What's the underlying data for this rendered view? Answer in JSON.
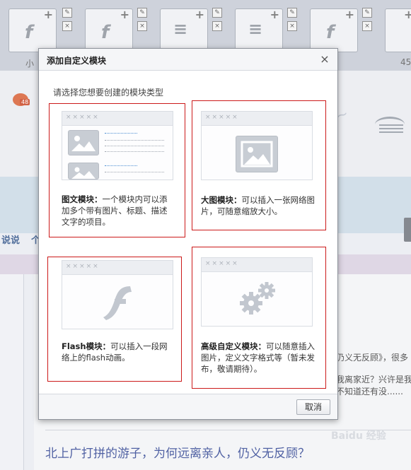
{
  "background": {
    "thumb_caption_left": "小",
    "thumb_caption_right": "45",
    "sidebar_text_1": "说说",
    "sidebar_text_2": "个",
    "right_text_1": "仍义无反顾》，很多",
    "right_text_2": "我离家近？兴许是我",
    "right_text_3": "不知道还有没......",
    "headline": "北上广打拼的游子，为何远离亲人，仍义无反顾？",
    "stamp_badge": "48",
    "watermark": "Baidu 经验"
  },
  "dialog": {
    "title": "添加自定义模块",
    "close_glyph": "×",
    "prompt": "请选择您想要创建的模块类型",
    "cancel_label": "取消"
  },
  "modules": [
    {
      "name_label": "图文模块：",
      "description": "一个模块内可以添加多个带有图片、标题、描述文字的项目。",
      "selected": true
    },
    {
      "name_label": "大图模块：",
      "description": "可以插入一张网络图片，可随意缩放大小。",
      "selected": true
    },
    {
      "name_label": "Flash模块：",
      "description": "可以插入一段网络上的flash动画。",
      "selected": true
    },
    {
      "name_label": "高级自定义模块：",
      "description": "可以随意插入图片，定义文字格式等（暂未发布，敬请期待）。",
      "selected": true
    }
  ],
  "preview_stars": "×××××",
  "preview_link_text": "xxxxxxxx",
  "icons": [
    "image-icon",
    "flash-icon",
    "gear-icon",
    "close-icon",
    "edit-icon",
    "delete-icon",
    "add-icon"
  ],
  "colors": {
    "selection_border": "#cc1a1a",
    "headline": "#2a3f8f",
    "link_placeholder": "#4d8fd3"
  }
}
